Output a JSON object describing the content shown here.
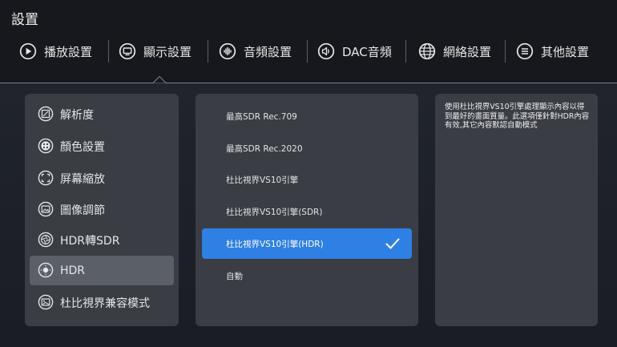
{
  "header": {
    "title": "設置"
  },
  "tabs": [
    {
      "label": "播放設置",
      "icon": "play-circle-icon"
    },
    {
      "label": "顯示設置",
      "icon": "monitor-icon",
      "active": true
    },
    {
      "label": "音頻設置",
      "icon": "equalizer-icon"
    },
    {
      "label": "DAC音頻",
      "icon": "speaker-icon"
    },
    {
      "label": "網絡設置",
      "icon": "globe-icon"
    },
    {
      "label": "其他設置",
      "icon": "menu-circle-icon"
    }
  ],
  "left_menu": {
    "items": [
      {
        "label": "解析度",
        "icon": "resolution-icon"
      },
      {
        "label": "顏色設置",
        "icon": "palette-icon"
      },
      {
        "label": "屏幕縮放",
        "icon": "expand-icon"
      },
      {
        "label": "圖像調節",
        "icon": "image-adjust-icon"
      },
      {
        "label": "HDR轉SDR",
        "icon": "aperture-icon"
      },
      {
        "label": "HDR",
        "icon": "hdr-icon",
        "active": true
      },
      {
        "label": "杜比視界兼容模式",
        "icon": "picture-icon"
      }
    ]
  },
  "options": {
    "items": [
      {
        "label": "最高SDR Rec.709"
      },
      {
        "label": "最高SDR Rec.2020"
      },
      {
        "label": "杜比視界VS10引擎"
      },
      {
        "label": "杜比視界VS10引擎(SDR)"
      },
      {
        "label": "杜比視界VS10引擎(HDR)",
        "selected": true
      },
      {
        "label": "自動"
      }
    ]
  },
  "description": {
    "text": "使用杜比視界VS10引擎處理顯示內容以得到最好的畫面質量。此選項僅針對HDR內容有效,其它內容默認自動模式"
  },
  "colors": {
    "background": "#16181d",
    "panel": "#3a3d43",
    "active_item": "#5b5f67",
    "selected_accent": "#2f80e4"
  }
}
